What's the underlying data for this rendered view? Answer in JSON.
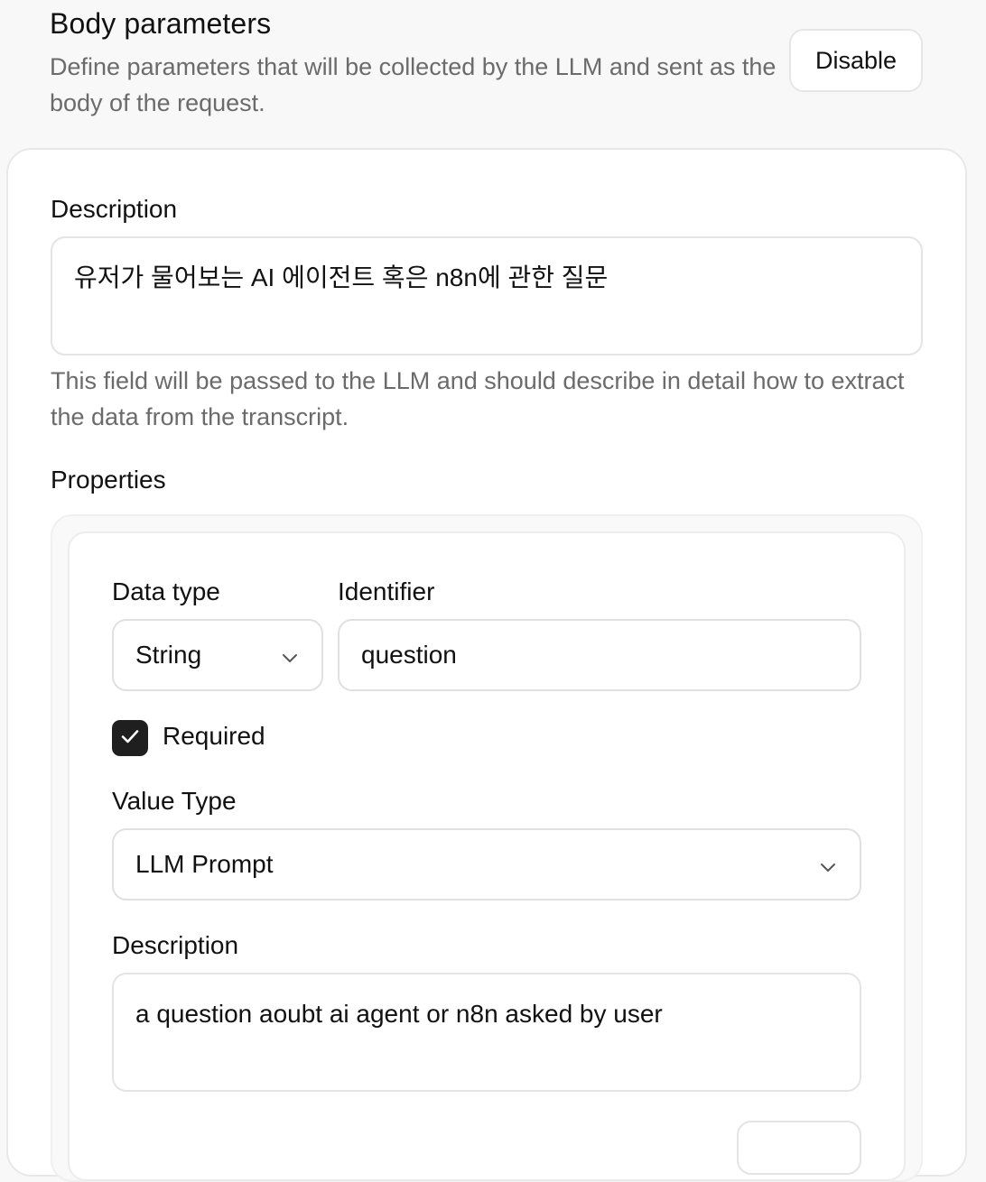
{
  "header": {
    "title": "Body parameters",
    "subtitle": "Define parameters that will be collected by the LLM and sent as the body of the request.",
    "disable_label": "Disable"
  },
  "body": {
    "description_label": "Description",
    "description_value": "유저가 물어보는 AI 에이전트 혹은 n8n에 관한 질문",
    "description_help": "This field will be passed to the LLM and should describe in detail how to extract the data from the transcript.",
    "properties_label": "Properties"
  },
  "property": {
    "data_type_label": "Data type",
    "data_type_value": "String",
    "identifier_label": "Identifier",
    "identifier_value": "question",
    "required_label": "Required",
    "required_checked": true,
    "value_type_label": "Value Type",
    "value_type_value": "LLM Prompt",
    "description_label": "Description",
    "description_value": "a question aoubt ai agent or n8n asked by user"
  },
  "icons": {
    "chevron": "chevron-down-icon",
    "check": "check-icon"
  },
  "colors": {
    "checkbox_fill": "#1f1f1f",
    "muted_text": "#6b6b6b",
    "border": "#e0e0e0"
  }
}
